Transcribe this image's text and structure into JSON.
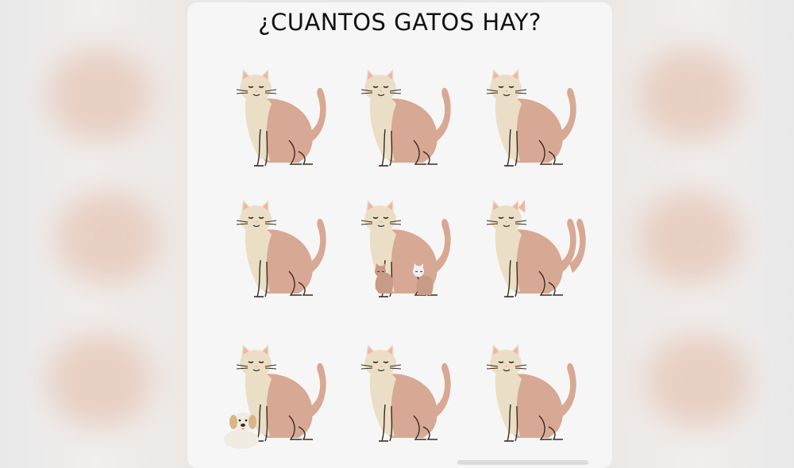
{
  "title": "¿CUANTOS GATOS HAY?",
  "colors": {
    "body": "#d7a893",
    "face": "#eadfc6",
    "ears": "#f3b3a5",
    "outline": "#3a2a22"
  },
  "grid": {
    "rows": 3,
    "cols": 3,
    "cells": [
      {
        "main": "cat"
      },
      {
        "main": "cat"
      },
      {
        "main": "cat"
      },
      {
        "main": "cat"
      },
      {
        "main": "cat",
        "extras": [
          "small-cat",
          "small-cat-white"
        ]
      },
      {
        "main": "cat",
        "extras": [
          "hidden-cat"
        ]
      },
      {
        "main": "cat",
        "extras": [
          "puppy"
        ]
      },
      {
        "main": "cat"
      },
      {
        "main": "cat"
      }
    ]
  }
}
